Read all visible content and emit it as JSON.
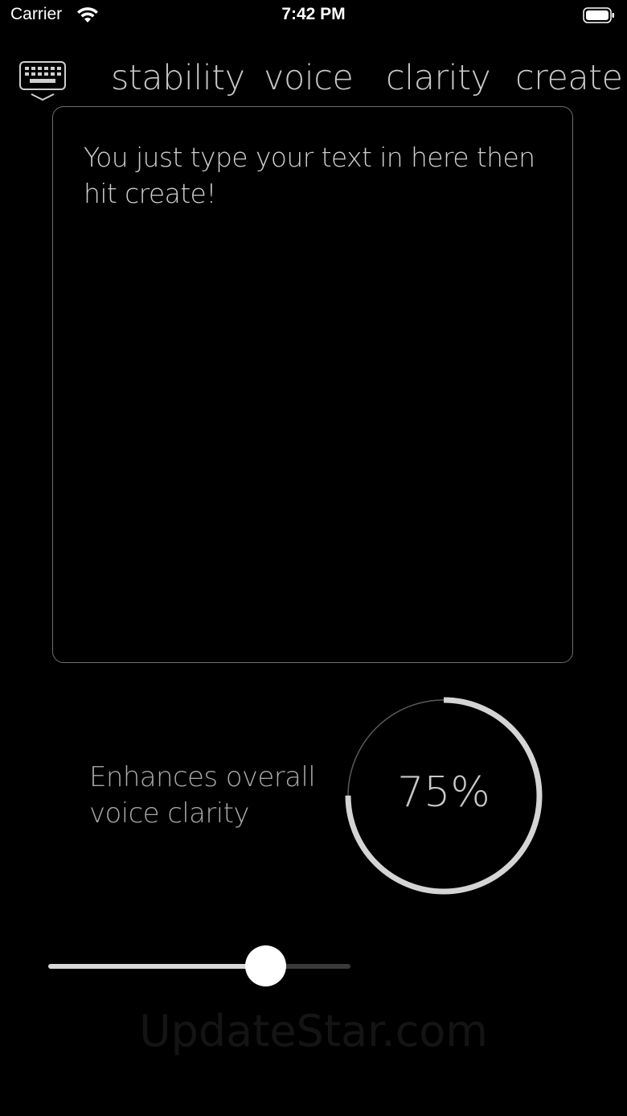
{
  "status_bar": {
    "carrier": "Carrier",
    "time": "7:42 PM"
  },
  "nav": {
    "stability": "stability",
    "voice": "voice",
    "clarity": "clarity",
    "create": "create"
  },
  "text_input": {
    "value": "You just type your text in here then hit create!"
  },
  "clarity": {
    "description": "Enhances overall voice clarity",
    "percent_label": "75%",
    "percent": 0.75
  },
  "slider": {
    "level": 0.72
  },
  "watermark": "UpdateStar.com",
  "colors": {
    "background": "#000000",
    "accent": "#d8d8d8",
    "muted": "#6e6e6e"
  },
  "icons": {
    "keyboard": "keyboard-dismiss-icon",
    "wifi": "wifi-icon",
    "battery": "battery-icon"
  }
}
